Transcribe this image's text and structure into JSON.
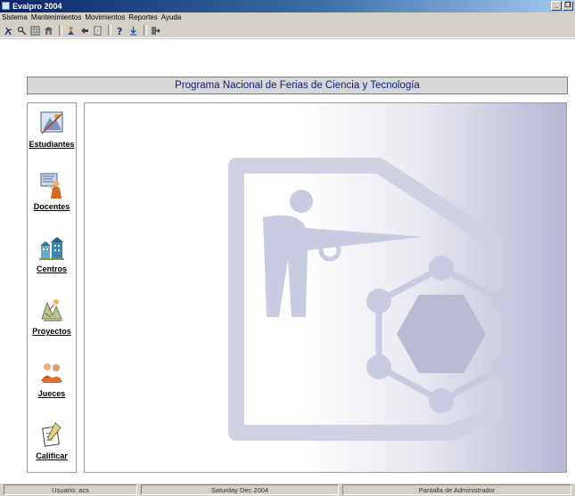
{
  "window": {
    "title": "Evalpro 2004",
    "buttons": {
      "minimize": "_",
      "maximize": "❐"
    }
  },
  "menu": {
    "items": [
      "Sistema",
      "Mantenimientos",
      "Movimientos",
      "Reportes",
      "Ayuda"
    ]
  },
  "toolbar": {
    "icons": [
      "run-icon",
      "wrench-icon",
      "grid-icon",
      "building-icon",
      "students-icon",
      "back-icon",
      "document-icon",
      "help-icon",
      "download-icon",
      "exit-icon"
    ]
  },
  "header": {
    "title": "Programa Nacional de Ferias de Ciencia y Tecnología"
  },
  "sidebar": {
    "items": [
      {
        "label": "Estudiantes",
        "icon": "students-icon"
      },
      {
        "label": "Docentes",
        "icon": "teacher-icon"
      },
      {
        "label": "Centros",
        "icon": "schools-icon"
      },
      {
        "label": "Proyectos",
        "icon": "projects-icon"
      },
      {
        "label": "Jueces",
        "icon": "judges-icon"
      },
      {
        "label": "Calificar",
        "icon": "grade-icon"
      }
    ]
  },
  "main": {
    "watermark": "logo-watermark"
  },
  "status": {
    "user": "Usuario:  acs",
    "date": "Saturday Dec 2004",
    "screen": "Pantalla de Administrador"
  },
  "colors": {
    "titlebar": "#0a246a",
    "header_text": "#0b1b86",
    "chrome": "#d4d0c8",
    "watermark": "#c9cbe0"
  }
}
